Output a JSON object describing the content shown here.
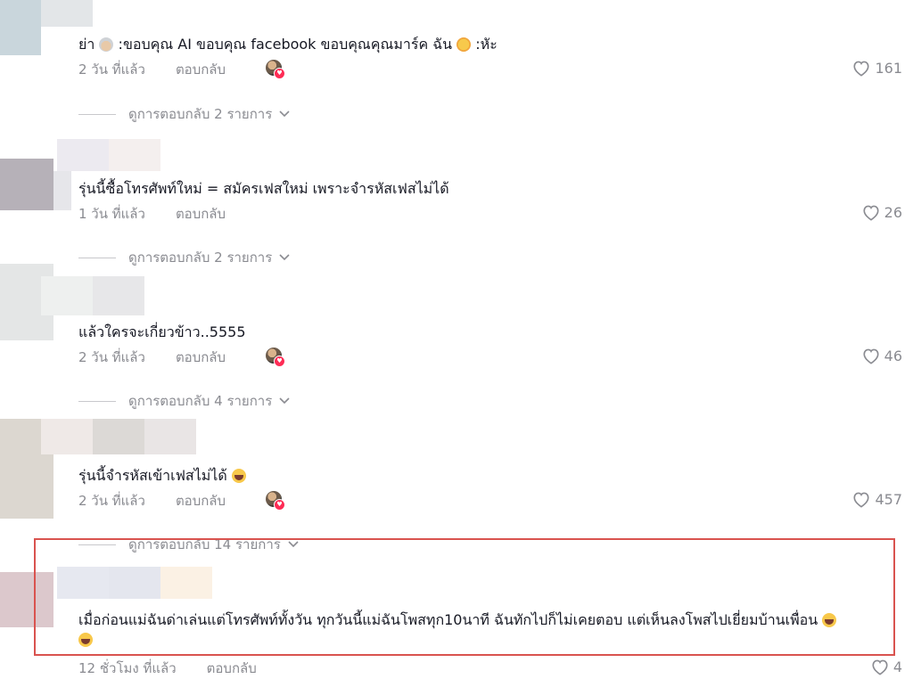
{
  "comments": [
    {
      "text_prefix": "ย่า",
      "text_main": " :ขอบคุณ AI ขอบคุณ facebook ขอบคุณคุณมาร์ค ฉัน",
      "text_suffix": " :หัะ",
      "time": "2 วัน ที่แล้ว",
      "reply_label": "ตอบกลับ",
      "likes": "161",
      "view_replies": "ดูการตอบกลับ 2 รายการ"
    },
    {
      "text": "รุ่นนี้ซื้อโทรศัพท์ใหม่ = สมัครเฟสใหม่ เพราะจำรหัสเฟสไม่ได้",
      "time": "1 วัน ที่แล้ว",
      "reply_label": "ตอบกลับ",
      "likes": "26",
      "view_replies": "ดูการตอบกลับ 2 รายการ"
    },
    {
      "text": "แล้วใครจะเกี่ยวข้าว..5555",
      "time": "2 วัน ที่แล้ว",
      "reply_label": "ตอบกลับ",
      "likes": "46",
      "view_replies": "ดูการตอบกลับ 4 รายการ"
    },
    {
      "text": "รุ่นนี้จำรหัสเข้าเฟสไม่ได้",
      "time": "2 วัน ที่แล้ว",
      "reply_label": "ตอบกลับ",
      "likes": "457",
      "view_replies": "ดูการตอบกลับ 14 รายการ"
    },
    {
      "text_line1": "เมื่อก่อนแม่ฉันด่าเล่นแต่โทรศัพท์ทั้งวัน ทุกวันนี้แม่ฉันโพสทุก10นาที ฉันทักไปก็ไม่เคยตอบ แต่เห็นลงโพสไปเยี่ยมบ้านเพื่อน",
      "time": "12 ชั่วโมง ที่แล้ว",
      "reply_label": "ตอบกลับ",
      "likes": "4"
    }
  ],
  "colors": {
    "text": "#161823",
    "muted": "#8a8b91",
    "highlight_border": "#d9534f",
    "badge": "#fe2c55"
  },
  "icons": {
    "like": "heart-outline-icon",
    "chevron": "chevron-down-icon"
  }
}
